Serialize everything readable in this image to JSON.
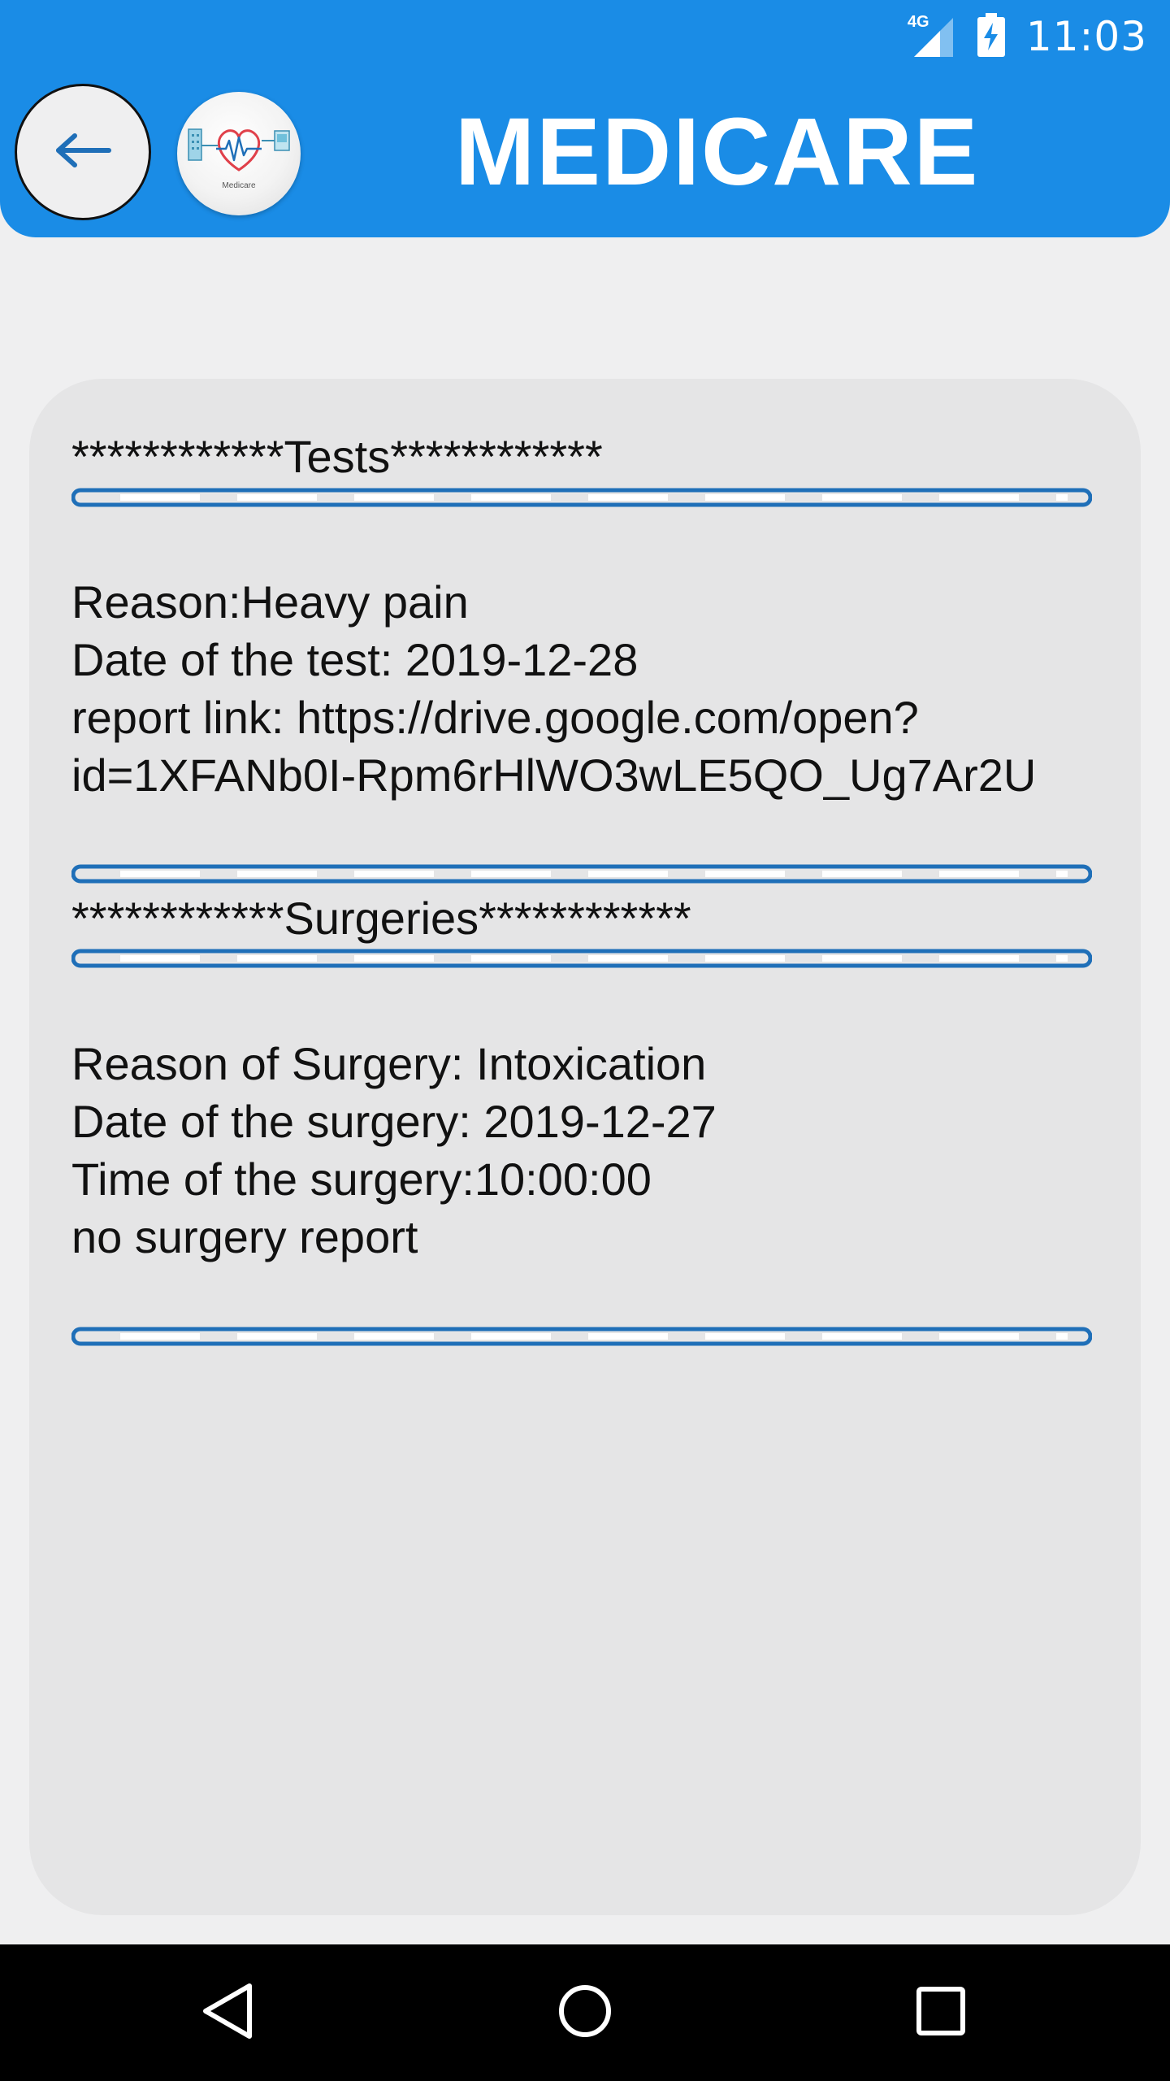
{
  "status_bar": {
    "network": "4G",
    "time": "11:03"
  },
  "header": {
    "title": "MEDICARE",
    "back_icon": "arrow-left-icon",
    "logo_caption": "Medicare"
  },
  "tests": {
    "heading": "************Tests************",
    "reason": "Reason:Heavy pain",
    "date": "Date of the test: 2019-12-28",
    "report_link_label": "report link: https://drive.google.com/open?",
    "report_link_id": "id=1XFANb0I-Rpm6rHlWO3wLE5QO_Ug7Ar2U"
  },
  "surgeries": {
    "heading": "************Surgeries************",
    "reason": "Reason of Surgery: Intoxication",
    "date": "Date of the surgery: 2019-12-27",
    "time": "Time of the surgery:10:00:00",
    "report": "no surgery report"
  },
  "navigation": {
    "back_icon": "triangle-back-icon",
    "home_icon": "circle-home-icon",
    "recents_icon": "square-recents-icon"
  },
  "colors": {
    "app_bar": "#1a8ce6",
    "divider": "#1f6fb8",
    "card": "#e5e5e6",
    "background": "#efeff0"
  }
}
